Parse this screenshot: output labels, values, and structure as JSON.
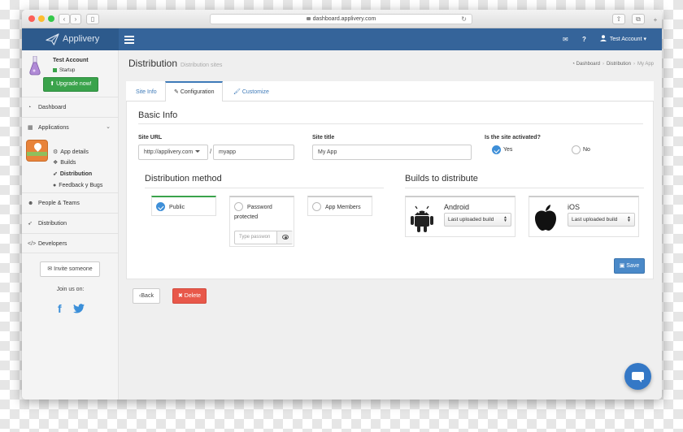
{
  "browser": {
    "url": "dashboard.applivery.com",
    "back_glyph": "‹",
    "forward_glyph": "›",
    "sidebar_glyph": "▯",
    "reload_glyph": "↻",
    "share_glyph": "⇧",
    "tabs_glyph": "⧉",
    "newtab_glyph": "+",
    "traffic_colors": [
      "#fc5f57",
      "#fdbc2e",
      "#34c84a"
    ]
  },
  "topnav": {
    "brand": "Applivery",
    "mail_icon": "✉",
    "help_icon": "?",
    "account_label": "Test Account",
    "account_caret": "▾"
  },
  "sidebar": {
    "account_name": "Test Account",
    "plan": "Startup",
    "upgrade_label": "Upgrade now!",
    "nav": {
      "dashboard": "Dashboard",
      "applications": "Applications",
      "people": "People & Teams",
      "distribution": "Distribution",
      "developers": "Developers"
    },
    "app_subitems": {
      "details": "App details",
      "builds": "Builds",
      "distribution": "Distribution",
      "feedback": "Feedback y Bugs"
    },
    "invite_label": "Invite someone",
    "join_us": "Join us on:",
    "facebook_glyph": "f",
    "twitter_glyph": "t"
  },
  "header": {
    "title": "Distribution",
    "subtitle": "Distribution sites",
    "breadcrumb": [
      "Dashboard",
      "Distribution",
      "My App"
    ]
  },
  "tabs": [
    "Site Info",
    "Configuration",
    "Customize"
  ],
  "basic_info": {
    "heading": "Basic Info",
    "site_url_label": "Site URL",
    "url_prefix": "http://applivery.com",
    "url_separator": "/",
    "url_slug": "myapp",
    "site_title_label": "Site title",
    "site_title_value": "My App",
    "activated_label": "Is the site activated?",
    "yes_label": "Yes",
    "no_label": "No",
    "activated": true
  },
  "distribution_method": {
    "heading": "Distribution method",
    "options": [
      "Public",
      "Password protected",
      "App Members"
    ],
    "selected": "Public",
    "password_placeholder": "Type passwon"
  },
  "builds": {
    "heading": "Builds to distribute",
    "platforms": [
      {
        "name": "Android",
        "selection": "Last uploaded build"
      },
      {
        "name": "iOS",
        "selection": "Last uploaded build"
      }
    ]
  },
  "actions": {
    "save": "Save",
    "back": "Back",
    "delete": "Delete"
  }
}
